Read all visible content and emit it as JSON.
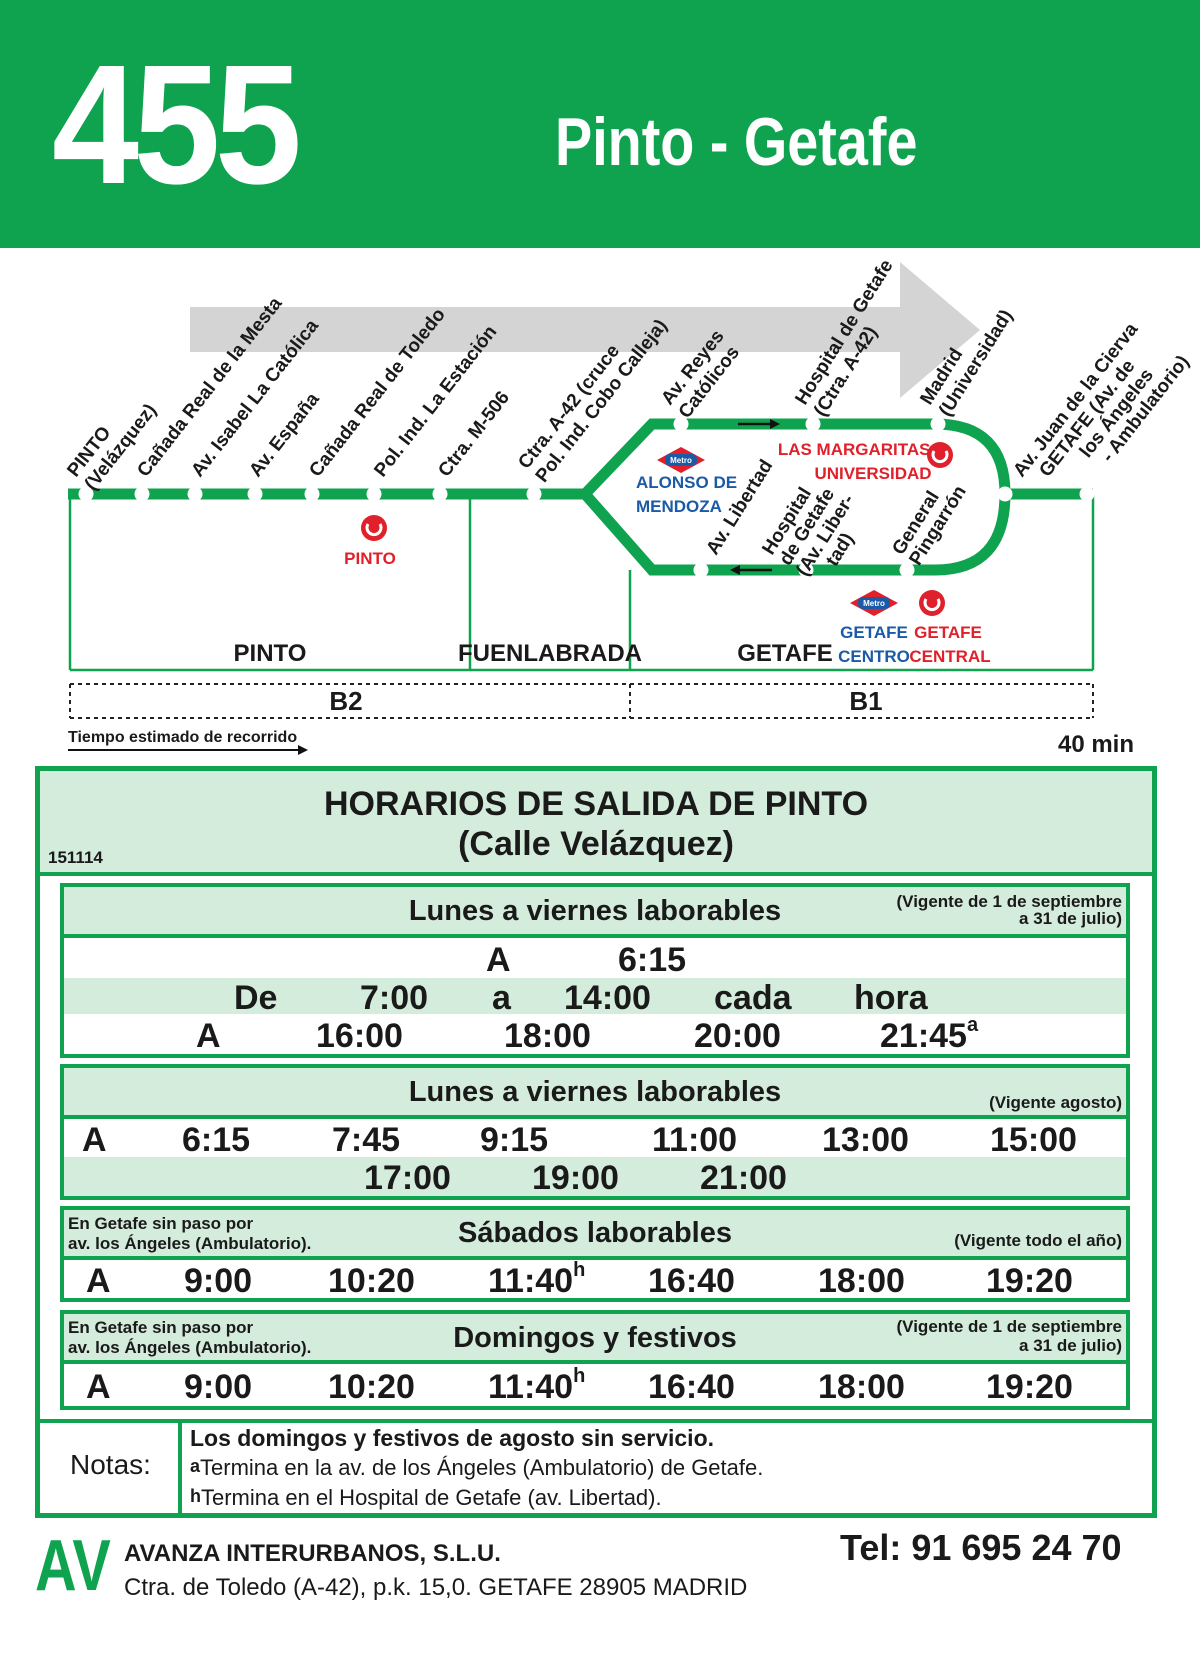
{
  "header": {
    "route_number": "455",
    "route_name": "Pinto - Getafe"
  },
  "map": {
    "stops_main": [
      "PINTO (Velázquez)",
      "Cañada Real de la Mesta",
      "Av. Isabel La Católica",
      "Av. España",
      "Cañada Real de Toledo",
      "Pol. Ind. La Estación",
      "Ctra. M-506",
      "Ctra. A-42 (cruce Pol. Ind. Cobo Calleja)",
      "Av. Reyes Católicos",
      "Hospital de Getafe (Ctra. A-42)",
      "Madrid (Universidad)",
      "Av. Juan de la Cierva",
      "GETAFE (Av. de los Ángeles - Ambulatorio)"
    ],
    "stop_labels": [
      {
        "l1": "PINTO",
        "l2": "(Velázquez)"
      },
      {
        "l1": "Cañada Real de la Mesta",
        "l2": ""
      },
      {
        "l1": "Av. Isabel La Católica",
        "l2": ""
      },
      {
        "l1": "Av. España",
        "l2": ""
      },
      {
        "l1": "Cañada Real de Toledo",
        "l2": ""
      },
      {
        "l1": "Pol. Ind. La Estación",
        "l2": ""
      },
      {
        "l1": "Ctra. M-506",
        "l2": ""
      },
      {
        "l1": "Ctra. A-42 (cruce",
        "l2": "Pol. Ind. Cobo Calleja)"
      },
      {
        "l1": "Av. Reyes",
        "l2": "Católicos"
      },
      {
        "l1": "Hospital de Getafe",
        "l2": "(Ctra. A-42)"
      },
      {
        "l1": "Madrid",
        "l2": "(Universidad)"
      },
      {
        "l1": "Av. Juan de la Cierva",
        "l2": ""
      },
      {
        "l1": "GETAFE (Av. de",
        "l2": "los Ángeles",
        "l3": "- Ambulatorio)"
      }
    ],
    "lower_stops": [
      {
        "l1": "Av. Libertad",
        "l2": "",
        "l3": ""
      },
      {
        "l1": "Hospital",
        "l2": "de Getafe",
        "l3": "(Av. Liber-",
        "l4": "tad)"
      },
      {
        "l1": "General",
        "l2": "Pingarrón",
        "l3": ""
      }
    ],
    "metro_badge": "Metro",
    "station_alonso": {
      "l1": "ALONSO DE",
      "l2": "MENDOZA"
    },
    "station_margaritas": {
      "l1": "LAS MARGARITAS-",
      "l2": "UNIVERSIDAD"
    },
    "station_pinto": "PINTO",
    "station_getafe_centro": {
      "l1": "GETAFE",
      "l2": "CENTRO"
    },
    "station_getafe_central": {
      "l1": "GETAFE",
      "l2": "CENTRAL"
    },
    "municipalities": [
      "PINTO",
      "FUENLABRADA",
      "GETAFE"
    ],
    "zones": [
      "B2",
      "B1"
    ],
    "travel_time_label": "Tiempo estimado de recorrido",
    "travel_time": "40 min",
    "colors": {
      "green": "#0fa34f",
      "metro_blue": "#1a5aa6",
      "cercanias_red": "#e0202a",
      "arrow_gray": "#d4d4d4"
    }
  },
  "schedule": {
    "title": "HORARIOS DE SALIDA DE PINTO",
    "subtitle": "(Calle Velázquez)",
    "code": "151114",
    "weekday": {
      "title": "Lunes a viernes laborables",
      "validity_l1": "(Vigente de 1 de septiembre",
      "validity_l2": "a 31 de julio)",
      "row1": [
        "A",
        "6:15"
      ],
      "row2": [
        "De",
        "7:00",
        "a",
        "14:00",
        "cada",
        "hora"
      ],
      "row3": [
        "A",
        "16:00",
        "18:00",
        "20:00",
        "21:45"
      ],
      "row3_sup": "a"
    },
    "weekday_august": {
      "title": "Lunes a viernes laborables",
      "validity": "(Vigente agosto)",
      "row1": [
        "A",
        "6:15",
        "7:45",
        "9:15",
        "11:00",
        "13:00",
        "15:00"
      ],
      "row2": [
        "17:00",
        "19:00",
        "21:00"
      ]
    },
    "saturday": {
      "note_l1": "En Getafe sin paso por",
      "note_l2": "av. los Ángeles (Ambulatorio).",
      "title": "Sábados laborables",
      "validity": "(Vigente todo el año)",
      "row": [
        "A",
        "9:00",
        "10:20",
        "11:40",
        "16:40",
        "18:00",
        "19:20"
      ],
      "sup": "h"
    },
    "sunday": {
      "note_l1": "En Getafe sin paso por",
      "note_l2": "av. los Ángeles (Ambulatorio).",
      "title": "Domingos y festivos",
      "validity_l1": "(Vigente de 1 de septiembre",
      "validity_l2": "a 31 de julio)",
      "row": [
        "A",
        "9:00",
        "10:20",
        "11:40",
        "16:40",
        "18:00",
        "19:20"
      ],
      "sup": "h"
    },
    "notes": {
      "label": "Notas:",
      "line1": "Los domingos y festivos de agosto sin servicio.",
      "a_mark": "a",
      "a_text": "Termina en la av. de los Ángeles (Ambulatorio) de Getafe.",
      "h_mark": "h",
      "h_text": "Termina en el Hospital de Getafe (av. Libertad)."
    }
  },
  "footer": {
    "logo": "AV",
    "company": "AVANZA INTERURBANOS, S.L.U.",
    "address": "Ctra. de Toledo (A-42), p.k. 15,0. GETAFE 28905 MADRID",
    "phone": "Tel: 91 695 24 70"
  }
}
